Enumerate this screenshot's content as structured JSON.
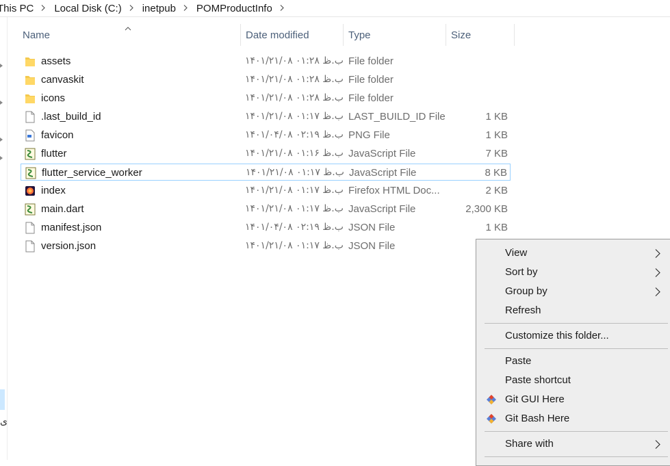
{
  "breadcrumb": {
    "items": [
      "This PC",
      "Local Disk (C:)",
      "inetpub",
      "POMProductInfo"
    ]
  },
  "columns": {
    "name": "Name",
    "date": "Date modified",
    "type": "Type",
    "size": "Size"
  },
  "files": [
    {
      "name": "assets",
      "date": "۱۴۰۱/۲۱/۰۸ ب.ظ ۰۱:۲۸",
      "type": "File folder",
      "size": "",
      "icon": "folder-icon"
    },
    {
      "name": "canvaskit",
      "date": "۱۴۰۱/۲۱/۰۸ ب.ظ ۰۱:۲۸",
      "type": "File folder",
      "size": "",
      "icon": "folder-icon"
    },
    {
      "name": "icons",
      "date": "۱۴۰۱/۲۱/۰۸ ب.ظ ۰۱:۲۸",
      "type": "File folder",
      "size": "",
      "icon": "folder-icon"
    },
    {
      "name": ".last_build_id",
      "date": "۱۴۰۱/۲۱/۰۸ ب.ظ ۰۱:۱۷",
      "type": "LAST_BUILD_ID File",
      "size": "1 KB",
      "icon": "blank-file-icon"
    },
    {
      "name": "favicon",
      "date": "۱۴۰۱/۰۴/۰۸ ب.ظ ۰۲:۱۹",
      "type": "PNG File",
      "size": "1 KB",
      "icon": "image-file-icon"
    },
    {
      "name": "flutter",
      "date": "۱۴۰۱/۲۱/۰۸ ب.ظ ۰۱:۱۶",
      "type": "JavaScript File",
      "size": "7 KB",
      "icon": "script-file-icon"
    },
    {
      "name": "flutter_service_worker",
      "date": "۱۴۰۱/۲۱/۰۸ ب.ظ ۰۱:۱۷",
      "type": "JavaScript File",
      "size": "8 KB",
      "icon": "script-file-icon"
    },
    {
      "name": "index",
      "date": "۱۴۰۱/۲۱/۰۸ ب.ظ ۰۱:۱۷",
      "type": "Firefox HTML Doc...",
      "size": "2 KB",
      "icon": "firefox-icon"
    },
    {
      "name": "main.dart",
      "date": "۱۴۰۱/۲۱/۰۸ ب.ظ ۰۱:۱۷",
      "type": "JavaScript File",
      "size": "2,300 KB",
      "icon": "script-file-icon"
    },
    {
      "name": "manifest.json",
      "date": "۱۴۰۱/۰۴/۰۸ ب.ظ ۰۲:۱۹",
      "type": "JSON File",
      "size": "1 KB",
      "icon": "blank-file-icon"
    },
    {
      "name": "version.json",
      "date": "۱۴۰۱/۲۱/۰۸ ب.ظ ۰۱:۱۷",
      "type": "JSON File",
      "size": "",
      "icon": "blank-file-icon"
    }
  ],
  "selected_file": "flutter_service_worker",
  "nav_pane": {
    "glyph": "ی"
  },
  "context_menu": {
    "view": "View",
    "sort_by": "Sort by",
    "group_by": "Group by",
    "refresh": "Refresh",
    "customize": "Customize this folder...",
    "paste": "Paste",
    "paste_shortcut": "Paste shortcut",
    "git_gui": "Git GUI Here",
    "git_bash": "Git Bash Here",
    "share_with": "Share with"
  },
  "colors": {
    "folder": "#f4c94e",
    "selection_border": "#99d1ff",
    "menu_bg": "#eeeeee",
    "header_text": "#4c607a",
    "git_red": "#e24329",
    "git_blue": "#5b7fd6"
  }
}
